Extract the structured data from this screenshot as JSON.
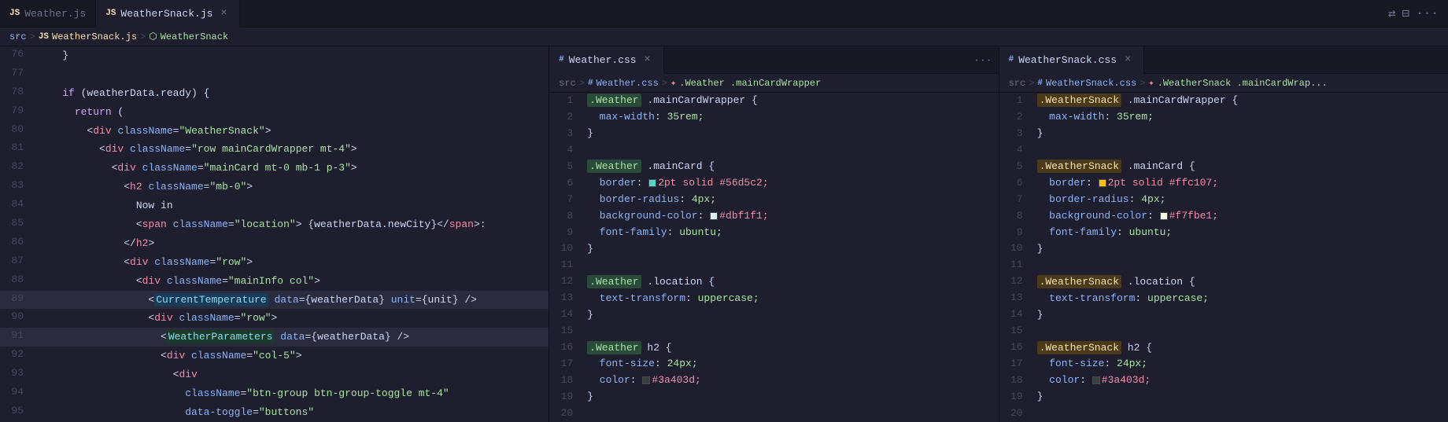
{
  "tabs": {
    "panel1": {
      "tabs": [
        {
          "label": "Weather.js",
          "icon": "JS",
          "active": false,
          "closeable": false
        },
        {
          "label": "WeatherSnack.js",
          "icon": "JS",
          "active": true,
          "closeable": true
        }
      ],
      "breadcrumb": [
        "src",
        ">",
        "JS",
        "WeatherSnack.js",
        ">",
        "⬡",
        "WeatherSnack"
      ]
    },
    "panel2": {
      "tabs": [
        {
          "label": "Weather.css",
          "icon": "#",
          "active": true,
          "closeable": true
        }
      ],
      "breadcrumb": [
        "src",
        ">",
        "#",
        "Weather.css",
        ">",
        "✦",
        ".Weather .mainCardWrapper"
      ]
    },
    "panel3": {
      "tabs": [
        {
          "label": "WeatherSnack.css",
          "icon": "#",
          "active": true,
          "closeable": true
        }
      ],
      "breadcrumb": [
        "src",
        ">",
        "#",
        "WeatherSnack.css",
        ">",
        "✦",
        ".WeatherSnack .mainCardWrap..."
      ]
    }
  },
  "panel1_lines": [
    {
      "num": 76,
      "code": "    }"
    },
    {
      "num": 77,
      "code": ""
    },
    {
      "num": 78,
      "code": "    if (weatherData.ready) {"
    },
    {
      "num": 79,
      "code": "      return ("
    },
    {
      "num": 80,
      "code": "        <div className=\"WeatherSnack\">"
    },
    {
      "num": 81,
      "code": "          <div className=\"row mainCardWrapper mt-4\">"
    },
    {
      "num": 82,
      "code": "            <div className=\"mainCard mt-0 mb-1 p-3\">"
    },
    {
      "num": 83,
      "code": "              <h2 className=\"mb-0\">"
    },
    {
      "num": 84,
      "code": "                Now in"
    },
    {
      "num": 85,
      "code": "                <span className=\"location\"> {weatherData.newCity}</span>:"
    },
    {
      "num": 86,
      "code": "              </h2>"
    },
    {
      "num": 87,
      "code": "              <div className=\"row\">"
    },
    {
      "num": 88,
      "code": "                <div className=\"mainInfo col\">"
    },
    {
      "num": 89,
      "code": "                  <CurrentTemperature data={weatherData} unit={unit} />"
    },
    {
      "num": 90,
      "code": "                  <div className=\"row\">"
    },
    {
      "num": 91,
      "code": "                    <WeatherParameters data={weatherData} />"
    },
    {
      "num": 92,
      "code": "                    <div className=\"col-5\">"
    },
    {
      "num": 93,
      "code": "                      <div"
    },
    {
      "num": 94,
      "code": "                        className=\"btn-group btn-group-toggle mt-4\""
    },
    {
      "num": 95,
      "code": "                        data-toggle=\"buttons\""
    }
  ],
  "panel2_lines": [
    {
      "num": 1,
      "code": ".Weather .mainCardWrapper {",
      "sel": "Weather"
    },
    {
      "num": 2,
      "code": "  max-width: 35rem;"
    },
    {
      "num": 3,
      "code": "}"
    },
    {
      "num": 4,
      "code": ""
    },
    {
      "num": 5,
      "code": ".Weather .mainCard {",
      "sel": "Weather"
    },
    {
      "num": 6,
      "code": "  border: 2pt solid #56d5c2;",
      "color": "#56d5c2"
    },
    {
      "num": 7,
      "code": "  border-radius: 4px;"
    },
    {
      "num": 8,
      "code": "  background-color: #dbf1f1;",
      "color": "#dbf1f1"
    },
    {
      "num": 9,
      "code": "  font-family: ubuntu;"
    },
    {
      "num": 10,
      "code": "}"
    },
    {
      "num": 11,
      "code": ""
    },
    {
      "num": 12,
      "code": ".Weather .location {",
      "sel": "Weather"
    },
    {
      "num": 13,
      "code": "  text-transform: uppercase;"
    },
    {
      "num": 14,
      "code": "}"
    },
    {
      "num": 15,
      "code": ""
    },
    {
      "num": 16,
      "code": ".Weather h2 {",
      "sel": "Weather"
    },
    {
      "num": 17,
      "code": "  font-size: 24px;"
    },
    {
      "num": 18,
      "code": "  color: #3a403d;",
      "color": "#3a403d"
    },
    {
      "num": 19,
      "code": "}"
    },
    {
      "num": 20,
      "code": ""
    }
  ],
  "panel3_lines": [
    {
      "num": 1,
      "code": ".WeatherSnack .mainCardWrapper {",
      "sel": "WeatherSnack"
    },
    {
      "num": 2,
      "code": "  max-width: 35rem;"
    },
    {
      "num": 3,
      "code": "}"
    },
    {
      "num": 4,
      "code": ""
    },
    {
      "num": 5,
      "code": ".WeatherSnack .mainCard {",
      "sel": "WeatherSnack"
    },
    {
      "num": 6,
      "code": "  border: 2pt solid #ffc107;",
      "color": "#ffc107"
    },
    {
      "num": 7,
      "code": "  border-radius: 4px;"
    },
    {
      "num": 8,
      "code": "  background-color: #f7fbe1;",
      "color": "#f7fbe1"
    },
    {
      "num": 9,
      "code": "  font-family: ubuntu;"
    },
    {
      "num": 10,
      "code": "}"
    },
    {
      "num": 11,
      "code": ""
    },
    {
      "num": 12,
      "code": ".WeatherSnack .location {",
      "sel": "WeatherSnack"
    },
    {
      "num": 13,
      "code": "  text-transform: uppercase;"
    },
    {
      "num": 14,
      "code": "}"
    },
    {
      "num": 15,
      "code": ""
    },
    {
      "num": 16,
      "code": ".WeatherSnack h2 {",
      "sel": "WeatherSnack"
    },
    {
      "num": 17,
      "code": "  font-size: 24px;"
    },
    {
      "num": 18,
      "code": "  color: #3a403d;",
      "color": "#3a403d"
    },
    {
      "num": 19,
      "code": "}"
    },
    {
      "num": 20,
      "code": ""
    }
  ]
}
